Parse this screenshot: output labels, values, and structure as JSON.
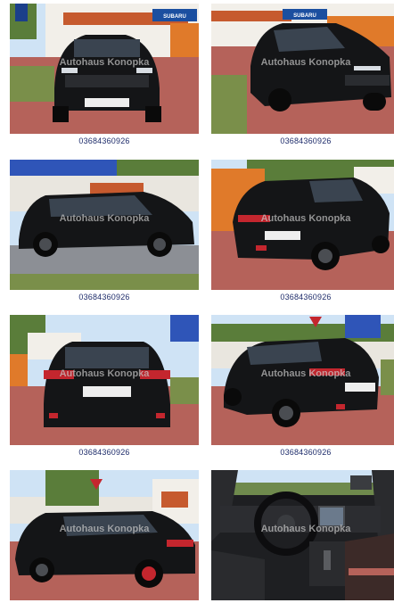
{
  "gallery": {
    "items": [
      {
        "caption": "03684360926",
        "watermark": "Autohaus Konopka",
        "sign": "SUBARU"
      },
      {
        "caption": "03684360926",
        "watermark": "Autohaus Konopka",
        "sign": "SUBARU"
      },
      {
        "caption": "03684360926",
        "watermark": "Autohaus Konopka"
      },
      {
        "caption": "03684360926",
        "watermark": "Autohaus Konopka"
      },
      {
        "caption": "03684360926",
        "watermark": "Autohaus Konopka"
      },
      {
        "caption": "03684360926",
        "watermark": "Autohaus Konopka"
      },
      {
        "caption": "",
        "watermark": "Autohaus Konopka"
      },
      {
        "caption": "",
        "watermark": "Autohaus Konopka"
      }
    ]
  },
  "colors": {
    "caption_text": "#1f2d6b",
    "car_body": "#141517",
    "pavement": "#b5625a",
    "sky": "#cfe3f5",
    "foliage": "#5a7d3a"
  }
}
